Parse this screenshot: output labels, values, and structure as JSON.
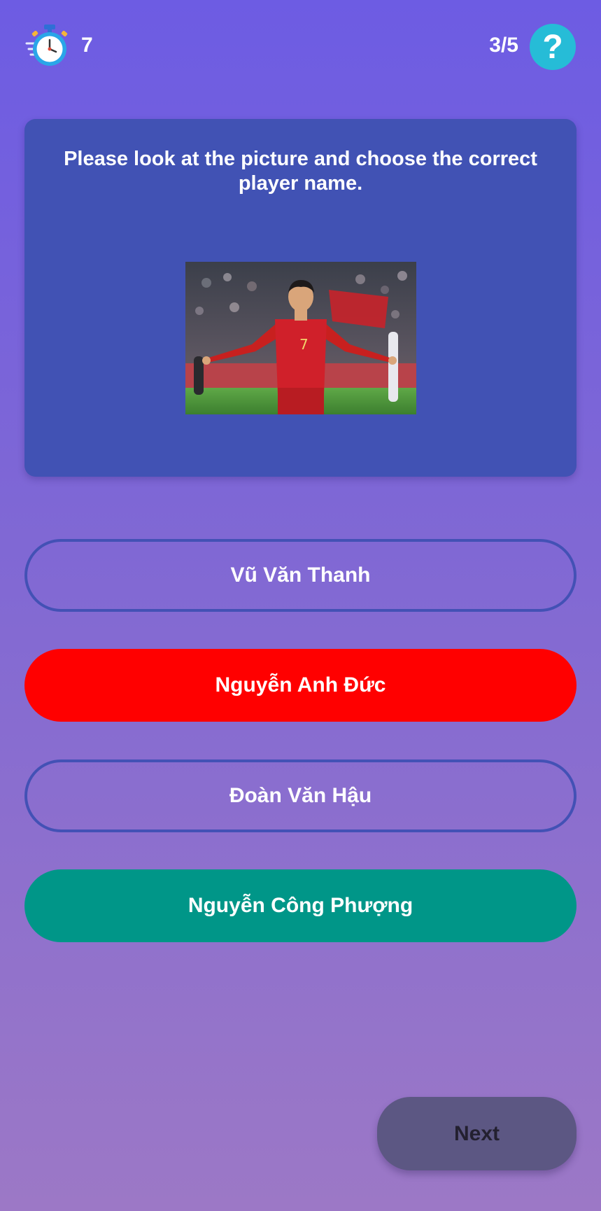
{
  "header": {
    "timer_icon": "stopwatch-icon",
    "timer_value": "7",
    "progress": "3/5",
    "help_label": "?",
    "help_icon": "question-icon"
  },
  "question": {
    "text": "Please look at the picture and choose the correct player name.",
    "image_icon": "player-photo"
  },
  "answers": [
    {
      "label": "Vũ Văn Thanh",
      "state": "default"
    },
    {
      "label": "Nguyễn Anh Đức",
      "state": "incorrect"
    },
    {
      "label": "Đoàn Văn Hậu",
      "state": "default"
    },
    {
      "label": "Nguyễn Công Phượng",
      "state": "correct"
    }
  ],
  "footer": {
    "next_label": "Next"
  },
  "colors": {
    "card": "#4152b4",
    "incorrect": "#ff0000",
    "correct": "#009688",
    "help": "#26bcd7",
    "next_button": "#5c5783"
  }
}
